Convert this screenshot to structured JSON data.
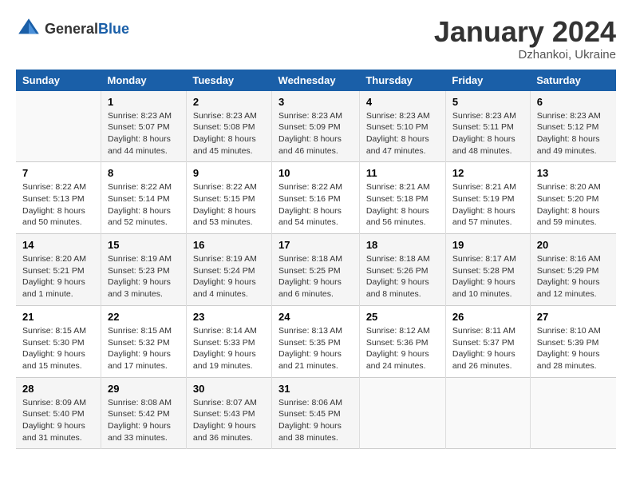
{
  "header": {
    "logo_general": "General",
    "logo_blue": "Blue",
    "month_title": "January 2024",
    "subtitle": "Dzhankoi, Ukraine"
  },
  "days_of_week": [
    "Sunday",
    "Monday",
    "Tuesday",
    "Wednesday",
    "Thursday",
    "Friday",
    "Saturday"
  ],
  "weeks": [
    [
      {
        "day": "",
        "info": ""
      },
      {
        "day": "1",
        "info": "Sunrise: 8:23 AM\nSunset: 5:07 PM\nDaylight: 8 hours\nand 44 minutes."
      },
      {
        "day": "2",
        "info": "Sunrise: 8:23 AM\nSunset: 5:08 PM\nDaylight: 8 hours\nand 45 minutes."
      },
      {
        "day": "3",
        "info": "Sunrise: 8:23 AM\nSunset: 5:09 PM\nDaylight: 8 hours\nand 46 minutes."
      },
      {
        "day": "4",
        "info": "Sunrise: 8:23 AM\nSunset: 5:10 PM\nDaylight: 8 hours\nand 47 minutes."
      },
      {
        "day": "5",
        "info": "Sunrise: 8:23 AM\nSunset: 5:11 PM\nDaylight: 8 hours\nand 48 minutes."
      },
      {
        "day": "6",
        "info": "Sunrise: 8:23 AM\nSunset: 5:12 PM\nDaylight: 8 hours\nand 49 minutes."
      }
    ],
    [
      {
        "day": "7",
        "info": "Sunrise: 8:22 AM\nSunset: 5:13 PM\nDaylight: 8 hours\nand 50 minutes."
      },
      {
        "day": "8",
        "info": "Sunrise: 8:22 AM\nSunset: 5:14 PM\nDaylight: 8 hours\nand 52 minutes."
      },
      {
        "day": "9",
        "info": "Sunrise: 8:22 AM\nSunset: 5:15 PM\nDaylight: 8 hours\nand 53 minutes."
      },
      {
        "day": "10",
        "info": "Sunrise: 8:22 AM\nSunset: 5:16 PM\nDaylight: 8 hours\nand 54 minutes."
      },
      {
        "day": "11",
        "info": "Sunrise: 8:21 AM\nSunset: 5:18 PM\nDaylight: 8 hours\nand 56 minutes."
      },
      {
        "day": "12",
        "info": "Sunrise: 8:21 AM\nSunset: 5:19 PM\nDaylight: 8 hours\nand 57 minutes."
      },
      {
        "day": "13",
        "info": "Sunrise: 8:20 AM\nSunset: 5:20 PM\nDaylight: 8 hours\nand 59 minutes."
      }
    ],
    [
      {
        "day": "14",
        "info": "Sunrise: 8:20 AM\nSunset: 5:21 PM\nDaylight: 9 hours\nand 1 minute."
      },
      {
        "day": "15",
        "info": "Sunrise: 8:19 AM\nSunset: 5:23 PM\nDaylight: 9 hours\nand 3 minutes."
      },
      {
        "day": "16",
        "info": "Sunrise: 8:19 AM\nSunset: 5:24 PM\nDaylight: 9 hours\nand 4 minutes."
      },
      {
        "day": "17",
        "info": "Sunrise: 8:18 AM\nSunset: 5:25 PM\nDaylight: 9 hours\nand 6 minutes."
      },
      {
        "day": "18",
        "info": "Sunrise: 8:18 AM\nSunset: 5:26 PM\nDaylight: 9 hours\nand 8 minutes."
      },
      {
        "day": "19",
        "info": "Sunrise: 8:17 AM\nSunset: 5:28 PM\nDaylight: 9 hours\nand 10 minutes."
      },
      {
        "day": "20",
        "info": "Sunrise: 8:16 AM\nSunset: 5:29 PM\nDaylight: 9 hours\nand 12 minutes."
      }
    ],
    [
      {
        "day": "21",
        "info": "Sunrise: 8:15 AM\nSunset: 5:30 PM\nDaylight: 9 hours\nand 15 minutes."
      },
      {
        "day": "22",
        "info": "Sunrise: 8:15 AM\nSunset: 5:32 PM\nDaylight: 9 hours\nand 17 minutes."
      },
      {
        "day": "23",
        "info": "Sunrise: 8:14 AM\nSunset: 5:33 PM\nDaylight: 9 hours\nand 19 minutes."
      },
      {
        "day": "24",
        "info": "Sunrise: 8:13 AM\nSunset: 5:35 PM\nDaylight: 9 hours\nand 21 minutes."
      },
      {
        "day": "25",
        "info": "Sunrise: 8:12 AM\nSunset: 5:36 PM\nDaylight: 9 hours\nand 24 minutes."
      },
      {
        "day": "26",
        "info": "Sunrise: 8:11 AM\nSunset: 5:37 PM\nDaylight: 9 hours\nand 26 minutes."
      },
      {
        "day": "27",
        "info": "Sunrise: 8:10 AM\nSunset: 5:39 PM\nDaylight: 9 hours\nand 28 minutes."
      }
    ],
    [
      {
        "day": "28",
        "info": "Sunrise: 8:09 AM\nSunset: 5:40 PM\nDaylight: 9 hours\nand 31 minutes."
      },
      {
        "day": "29",
        "info": "Sunrise: 8:08 AM\nSunset: 5:42 PM\nDaylight: 9 hours\nand 33 minutes."
      },
      {
        "day": "30",
        "info": "Sunrise: 8:07 AM\nSunset: 5:43 PM\nDaylight: 9 hours\nand 36 minutes."
      },
      {
        "day": "31",
        "info": "Sunrise: 8:06 AM\nSunset: 5:45 PM\nDaylight: 9 hours\nand 38 minutes."
      },
      {
        "day": "",
        "info": ""
      },
      {
        "day": "",
        "info": ""
      },
      {
        "day": "",
        "info": ""
      }
    ]
  ]
}
